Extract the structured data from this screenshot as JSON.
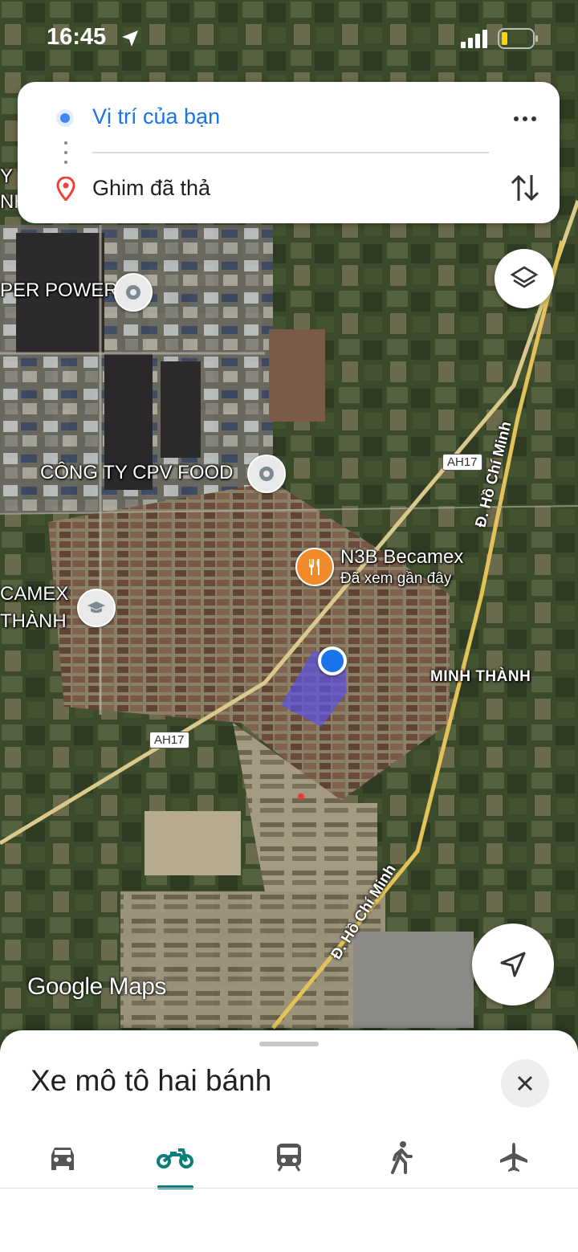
{
  "status_bar": {
    "time": "16:45"
  },
  "route": {
    "origin": "Vị trí của bạn",
    "destination": "Ghim đã thả"
  },
  "map": {
    "labels": {
      "power": "PER POWER",
      "cpv_food": "CÔNG TY CPV FOOD",
      "n3b": "N3B Becamex",
      "n3b_sub": "Đã xem gần đây",
      "becamex_left_1": "CAMEX",
      "becamex_left_2": "THÀNH",
      "minh_thanh": "MINH THÀNH",
      "edge_1": "Y T",
      "edge_2": "NH"
    },
    "roads": {
      "ah17_a": "AH17",
      "ah17_b": "AH17",
      "hcm_top": "Đ. Hồ Chí Minh",
      "hcm_bottom": "Đ. Hồ Chí Minh"
    },
    "attribution": "Google Maps"
  },
  "sheet": {
    "title": "Xe mô tô hai bánh",
    "modes": [
      "car-icon",
      "motorbike-icon",
      "transit-icon",
      "walk-icon",
      "flight-icon"
    ],
    "selected_mode": "motorbike-icon"
  },
  "colors": {
    "accent": "#1a73e8",
    "tab_selected": "#0b7e79",
    "pin_red": "#ea4335"
  }
}
